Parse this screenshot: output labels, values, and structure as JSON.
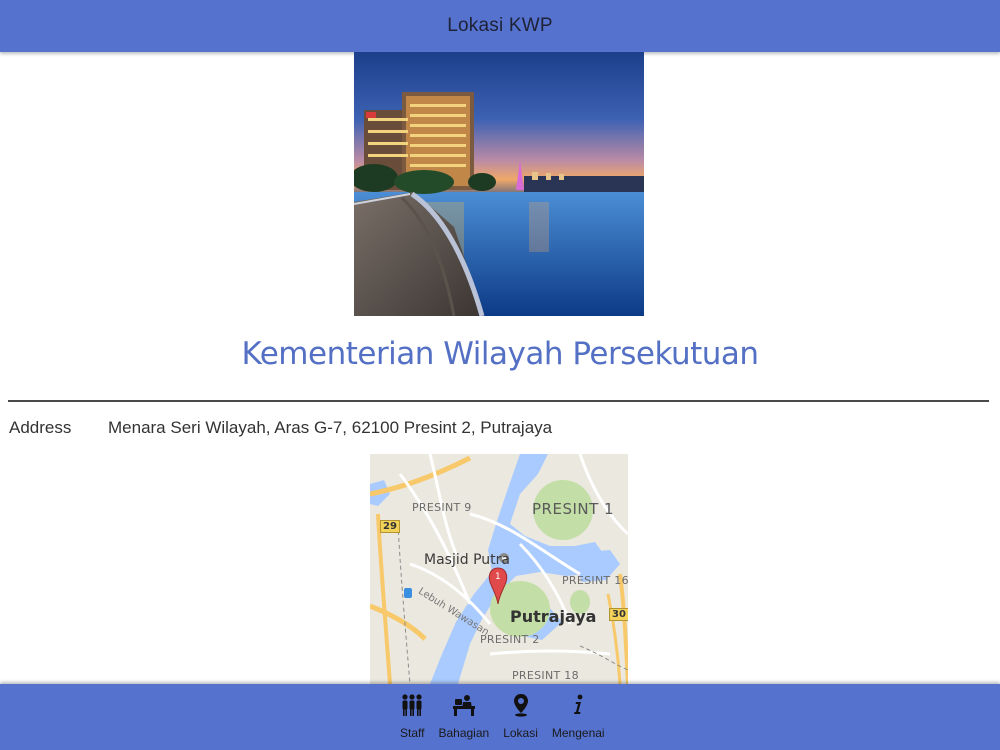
{
  "header": {
    "title": "Lokasi KWP"
  },
  "org": {
    "name": "Kementerian Wilayah Persekutuan"
  },
  "address": {
    "label": "Address",
    "value": "Menara Seri Wilayah, Aras G-7, 62100 Presint 2, Putrajaya"
  },
  "map": {
    "labels": {
      "presint9": "PRESINT 9",
      "presint1": "PRESINT 1",
      "masjid": "Masjid Putra",
      "presint16": "PRESINT 16",
      "road": "Lebuh Wawasan",
      "city": "Putrajaya",
      "presint2": "PRESINT 2",
      "presint18": "PRESINT 18",
      "shield29": "29",
      "shield30": "30"
    },
    "marker_label": "1"
  },
  "nav": {
    "items": [
      {
        "label": "Staff",
        "icon": "staff-icon"
      },
      {
        "label": "Bahagian",
        "icon": "division-icon"
      },
      {
        "label": "Lokasi",
        "icon": "location-icon"
      },
      {
        "label": "Mengenai",
        "icon": "info-icon"
      }
    ]
  },
  "colors": {
    "bar": "#5672cf",
    "title": "#5470c4"
  }
}
